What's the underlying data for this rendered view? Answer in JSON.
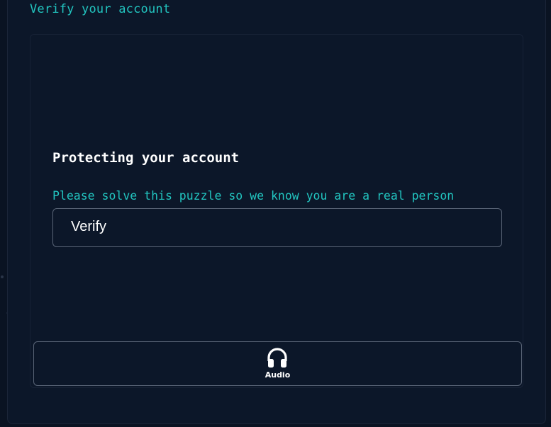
{
  "header": {
    "title": "Verify your account"
  },
  "challenge": {
    "heading": "Protecting your account",
    "instructions": "Please solve this puzzle so we know you are a real person",
    "verify_label": "Verify"
  },
  "audio": {
    "label": "Audio",
    "icon": "headphones-icon"
  },
  "colors": {
    "background": "#0c1729",
    "accent": "#22c5c0",
    "text": "#ffffff",
    "border": "#5a6577"
  }
}
